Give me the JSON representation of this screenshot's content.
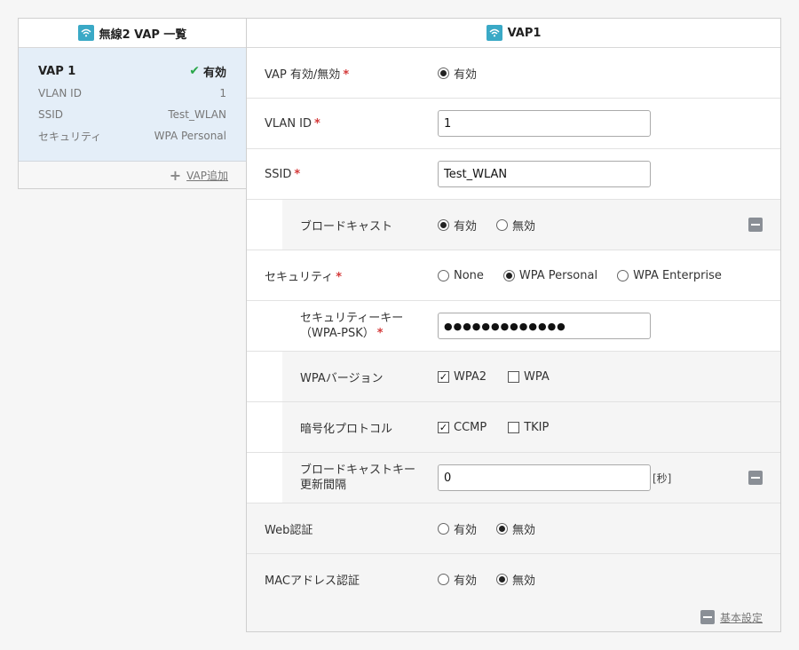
{
  "left_panel": {
    "title": "無線2 VAP 一覧",
    "vap": {
      "name": "VAP 1",
      "status": "有効",
      "rows": [
        {
          "label": "VLAN ID",
          "value": "1"
        },
        {
          "label": "SSID",
          "value": "Test_WLAN"
        },
        {
          "label": "セキュリティ",
          "value": "WPA Personal"
        }
      ]
    },
    "add_label": "VAP追加"
  },
  "right_panel": {
    "title": "VAP1",
    "vap_enable": {
      "label": "VAP 有効/無効",
      "option": "有効"
    },
    "vlan_id": {
      "label": "VLAN ID",
      "value": "1"
    },
    "ssid": {
      "label": "SSID",
      "value": "Test_WLAN"
    },
    "broadcast": {
      "label": "ブロードキャスト",
      "options": [
        "有効",
        "無効"
      ],
      "selected": "有効"
    },
    "security": {
      "label": "セキュリティ",
      "options": [
        "None",
        "WPA Personal",
        "WPA Enterprise"
      ],
      "selected": "WPA Personal"
    },
    "psk": {
      "label_line1": "セキュリティーキー",
      "label_line2": "（WPA-PSK）",
      "value": "●●●●●●●●●●●●●"
    },
    "wpa_version": {
      "label": "WPAバージョン",
      "options": [
        "WPA2",
        "WPA"
      ],
      "checked": [
        "WPA2"
      ]
    },
    "cipher": {
      "label": "暗号化プロトコル",
      "options": [
        "CCMP",
        "TKIP"
      ],
      "checked": [
        "CCMP"
      ]
    },
    "rekey": {
      "label_line1": "ブロードキャストキー",
      "label_line2": "更新間隔",
      "value": "0",
      "unit": "[秒]"
    },
    "web_auth": {
      "label": "Web認証",
      "options": [
        "有効",
        "無効"
      ],
      "selected": "無効"
    },
    "mac_auth": {
      "label": "MACアドレス認証",
      "options": [
        "有効",
        "無効"
      ],
      "selected": "無効"
    },
    "basic_settings": "基本設定"
  },
  "colors": {
    "accent": "#3aa9c6",
    "required": "#d43a3a",
    "check": "#2aa74a",
    "selected_card": "#e4eef8"
  }
}
